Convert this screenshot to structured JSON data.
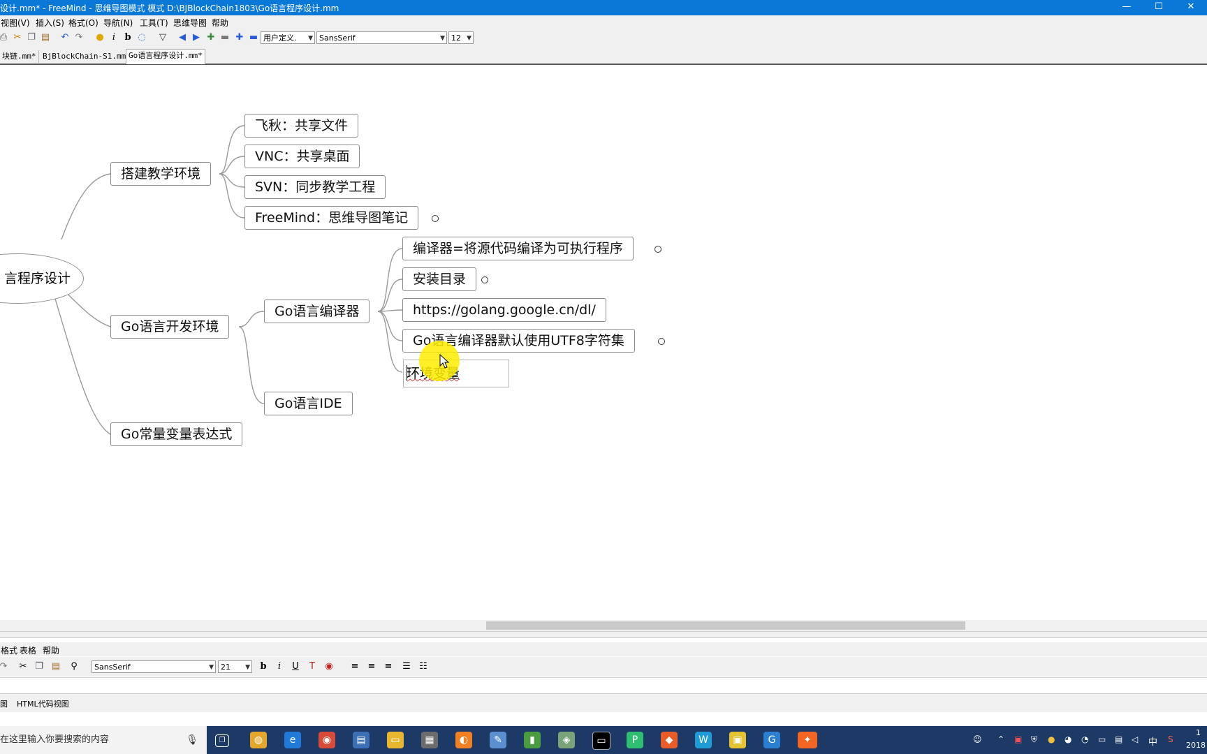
{
  "window": {
    "title": "设计.mm* - FreeMind - 思维导图模式 模式 D:\\BJBlockChain1803\\Go语言程序设计.mm",
    "controls": [
      "—",
      "☐",
      "✕"
    ]
  },
  "menu": [
    "视图(V)",
    "插入(S)",
    "格式(O)",
    "导航(N)",
    "工具(T)",
    "思维导图",
    "帮助"
  ],
  "toolbar": {
    "style_combo": "用户定义.",
    "font_combo": "SansSerif",
    "size_combo": "12"
  },
  "tabs": [
    "块链.mm*",
    "BjBlockChain-S1.mm*",
    "Go语言程序设计.mm*"
  ],
  "mindmap": {
    "root": "言程序设计",
    "nodes": {
      "env_setup": "搭建教学环境",
      "feiqiu": "飞秋：共享文件",
      "vnc": "VNC：共享桌面",
      "svn": "SVN：同步教学工程",
      "freemind": "FreeMind：思维导图笔记",
      "go_dev": "Go语言开发环境",
      "go_compiler": "Go语言编译器",
      "compiler_def": "编译器=将源代码编译为可执行程序",
      "install_dir": "安装目录",
      "url": "https://golang.google.cn/dl/",
      "utf8": "Go语言编译器默认使用UTF8字符集",
      "go_ide": "Go语言IDE",
      "go_const": "Go常量变量表达式"
    },
    "editing_text": "环境变量"
  },
  "note_editor": {
    "menu": [
      "格式",
      "表格",
      "帮助"
    ],
    "font_combo": "SansSerif",
    "size_combo": "21",
    "view_tabs": [
      "图",
      "HTML代码视图"
    ]
  },
  "taskbar": {
    "search_placeholder": "在这里输入你要搜索的内容",
    "ime": "中",
    "clock_time": "1",
    "clock_date": "2018"
  },
  "colors": {
    "titlebar": "#0a78d7",
    "taskbar": "#1d3a66",
    "highlight": "#ffec00"
  }
}
